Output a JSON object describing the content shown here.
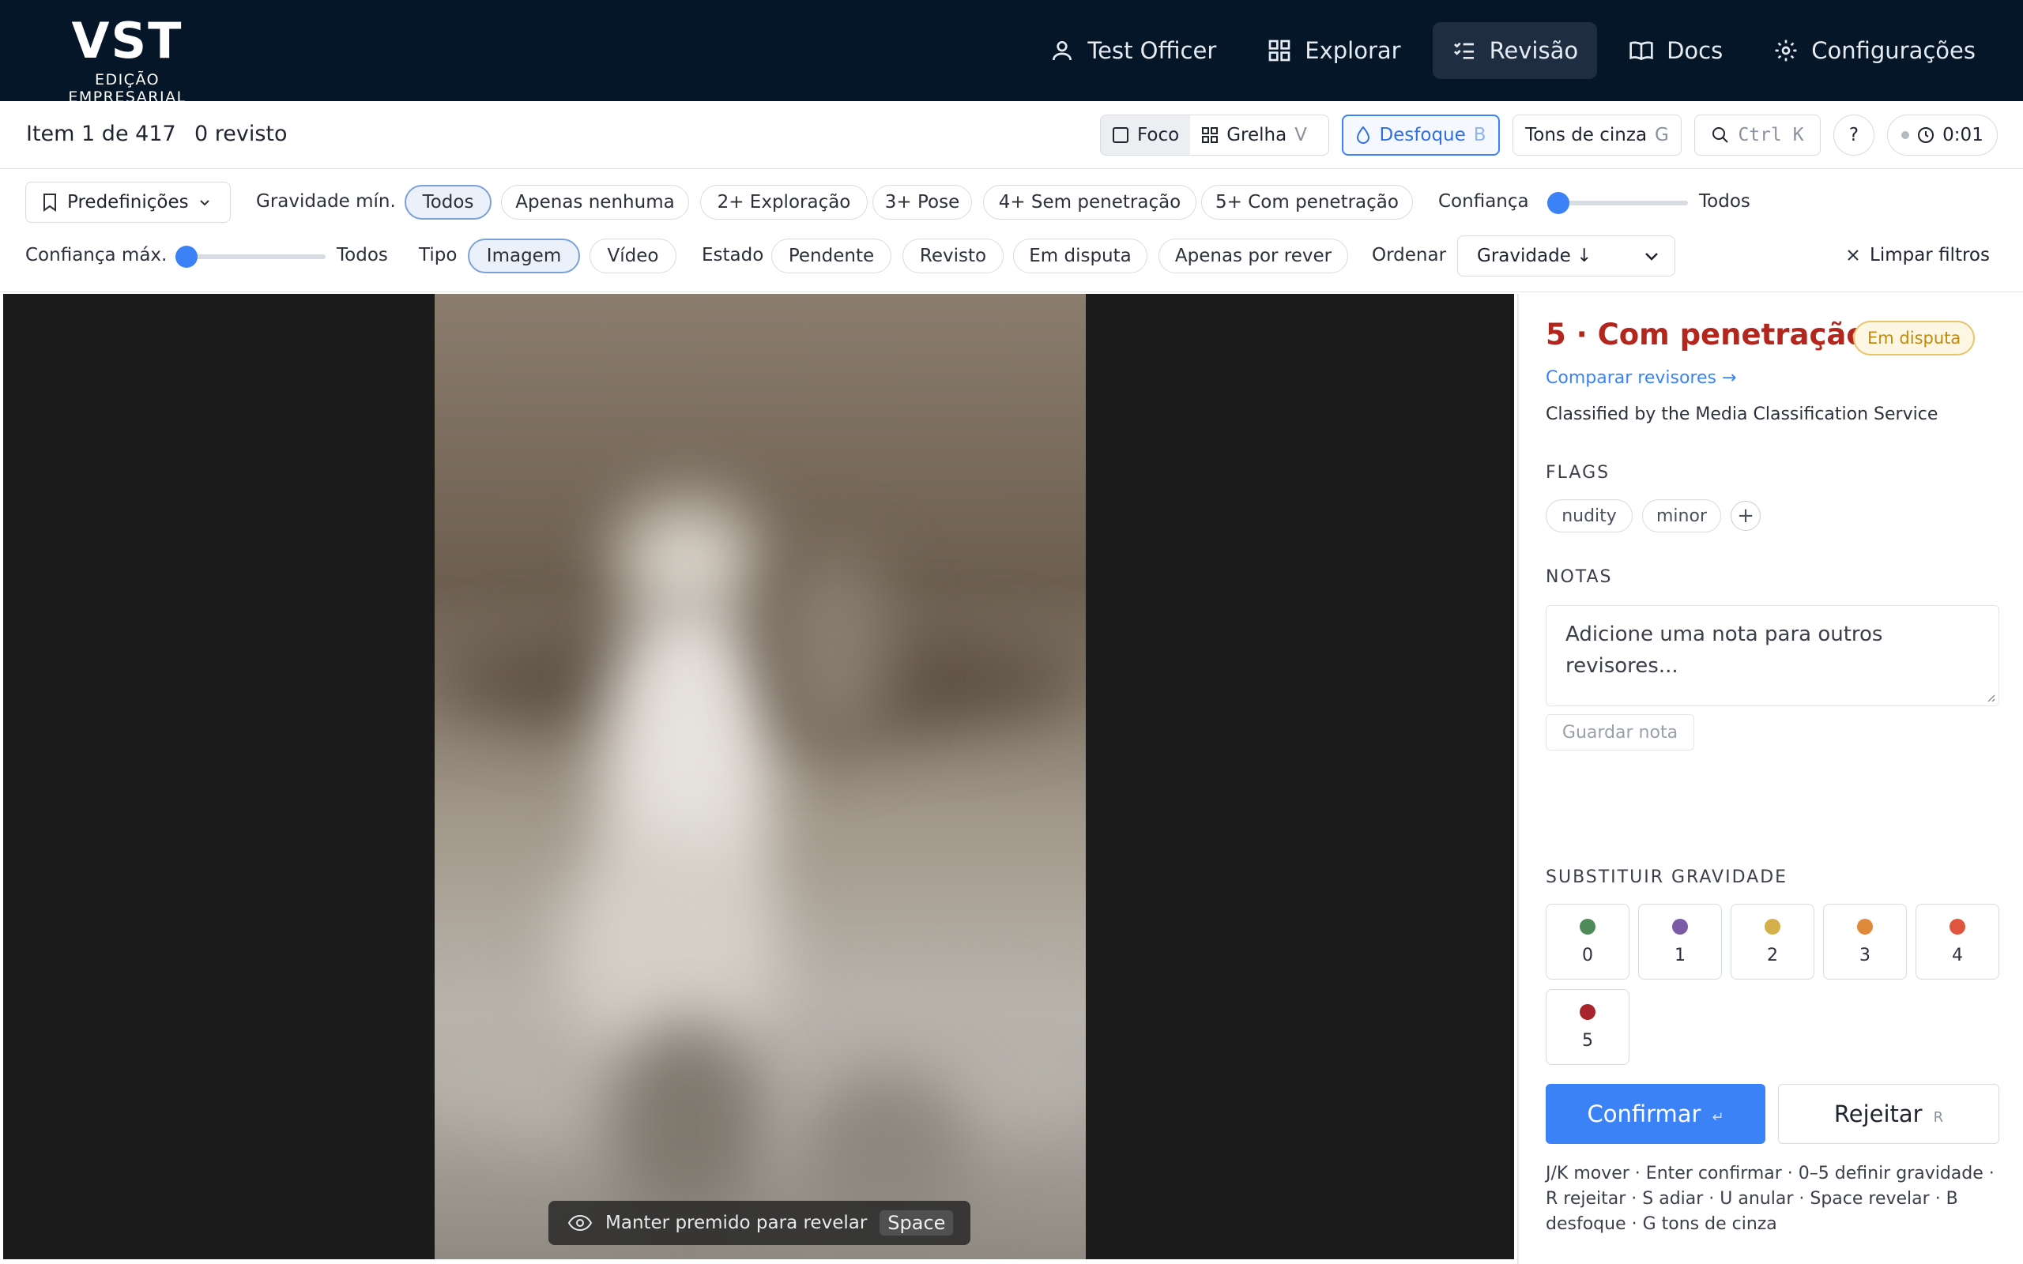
{
  "logo": {
    "main": "VST",
    "sub": "EDIÇÃO EMPRESARIAL"
  },
  "nav": [
    {
      "label": "Test Officer",
      "icon": "user-icon"
    },
    {
      "label": "Explorar",
      "icon": "grid-icon"
    },
    {
      "label": "Revisão",
      "icon": "checklist-icon",
      "active": true
    },
    {
      "label": "Docs",
      "icon": "book-icon"
    },
    {
      "label": "Configurações",
      "icon": "gear-icon"
    }
  ],
  "status": {
    "item": "Item 1 de 417",
    "reviewed": "0 revisto",
    "focus": "Foco",
    "grid": "Grelha",
    "grid_key": "V",
    "blur": "Desfoque",
    "blur_key": "B",
    "grayscale": "Tons de cinza",
    "grayscale_key": "G",
    "search_key": "Ctrl K",
    "help": "?",
    "timer": "0:01"
  },
  "filters": {
    "presets": "Predefinições",
    "min_severity_label": "Gravidade mín.",
    "severity_chips": [
      "Todos",
      "Apenas nenhuma",
      "2+ Exploração",
      "3+ Pose",
      "4+ Sem penetração",
      "5+ Com penetração"
    ],
    "confidence_label": "Confiança",
    "confidence_value": "Todos",
    "max_confidence_label": "Confiança máx.",
    "max_confidence_value": "Todos",
    "type_label": "Tipo",
    "type_chips": [
      "Imagem",
      "Vídeo"
    ],
    "state_label": "Estado",
    "state_chips": [
      "Pendente",
      "Revisto",
      "Em disputa",
      "Apenas por rever"
    ],
    "sort_label": "Ordenar",
    "sort_value": "Gravidade ↓",
    "clear": "Limpar filtros"
  },
  "viewer": {
    "reveal_hint": "Manter premido para revelar",
    "reveal_key": "Space"
  },
  "panel": {
    "severity_title": "5 · Com penetração",
    "badge": "Em disputa",
    "compare": "Comparar revisores →",
    "classified": "Classified by the Media Classification Service",
    "flags_label": "FLAGS",
    "flags": [
      "nudity",
      "minor"
    ],
    "flag_add": "+",
    "notes_label": "NOTAS",
    "notes_placeholder": "Adicione uma nota para outros revisores...",
    "save_note": "Guardar nota",
    "override_label": "SUBSTITUIR GRAVIDADE",
    "severity_levels": [
      {
        "value": "0",
        "color": "#4f8a5b"
      },
      {
        "value": "1",
        "color": "#7b5aa6"
      },
      {
        "value": "2",
        "color": "#d4b04a"
      },
      {
        "value": "3",
        "color": "#e0893a"
      },
      {
        "value": "4",
        "color": "#e0553d"
      },
      {
        "value": "5",
        "color": "#a8232a"
      }
    ],
    "confirm": "Confirmar",
    "confirm_key": "↵",
    "reject": "Rejeitar",
    "reject_key": "R",
    "hints": "J/K mover · Enter confirmar · 0–5 definir gravidade · R rejeitar · S adiar · U anular · Space revelar · B desfoque · G tons de cinza"
  },
  "colors": {
    "nav_bg": "#061629",
    "accent": "#3b82f6",
    "severity_title": "#b3261e",
    "dispute_badge": "#c28a0a"
  }
}
